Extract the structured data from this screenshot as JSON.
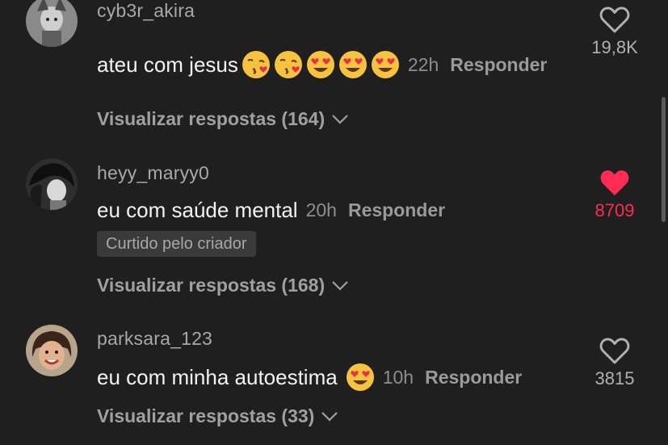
{
  "comments": [
    {
      "username": "cyb3r_akira",
      "text": "ateu com jesus",
      "time": "22h",
      "reply_label": "Responder",
      "likes": "19,8K",
      "liked": false,
      "view_replies": "Visualizar respostas (164)",
      "emojis": [
        "kissing-heart",
        "kissing-heart",
        "heart-eyes",
        "heart-eyes",
        "heart-eyes"
      ]
    },
    {
      "username": "heyy_maryy0",
      "text": "eu com saúde mental",
      "time": "20h",
      "reply_label": "Responder",
      "badge": "Curtido pelo criador",
      "likes": "8709",
      "liked": true,
      "view_replies": "Visualizar respostas (168)"
    },
    {
      "username": "parksara_123",
      "text": "eu com minha autoestima",
      "time": "10h",
      "reply_label": "Responder",
      "likes": "3815",
      "liked": false,
      "view_replies": "Visualizar respostas (33)",
      "emojis": [
        "heart-eyes"
      ]
    }
  ],
  "colors": {
    "background": "#1f1f1f",
    "liked": "#fe2c55",
    "muted_text": "#a8a8a8"
  }
}
